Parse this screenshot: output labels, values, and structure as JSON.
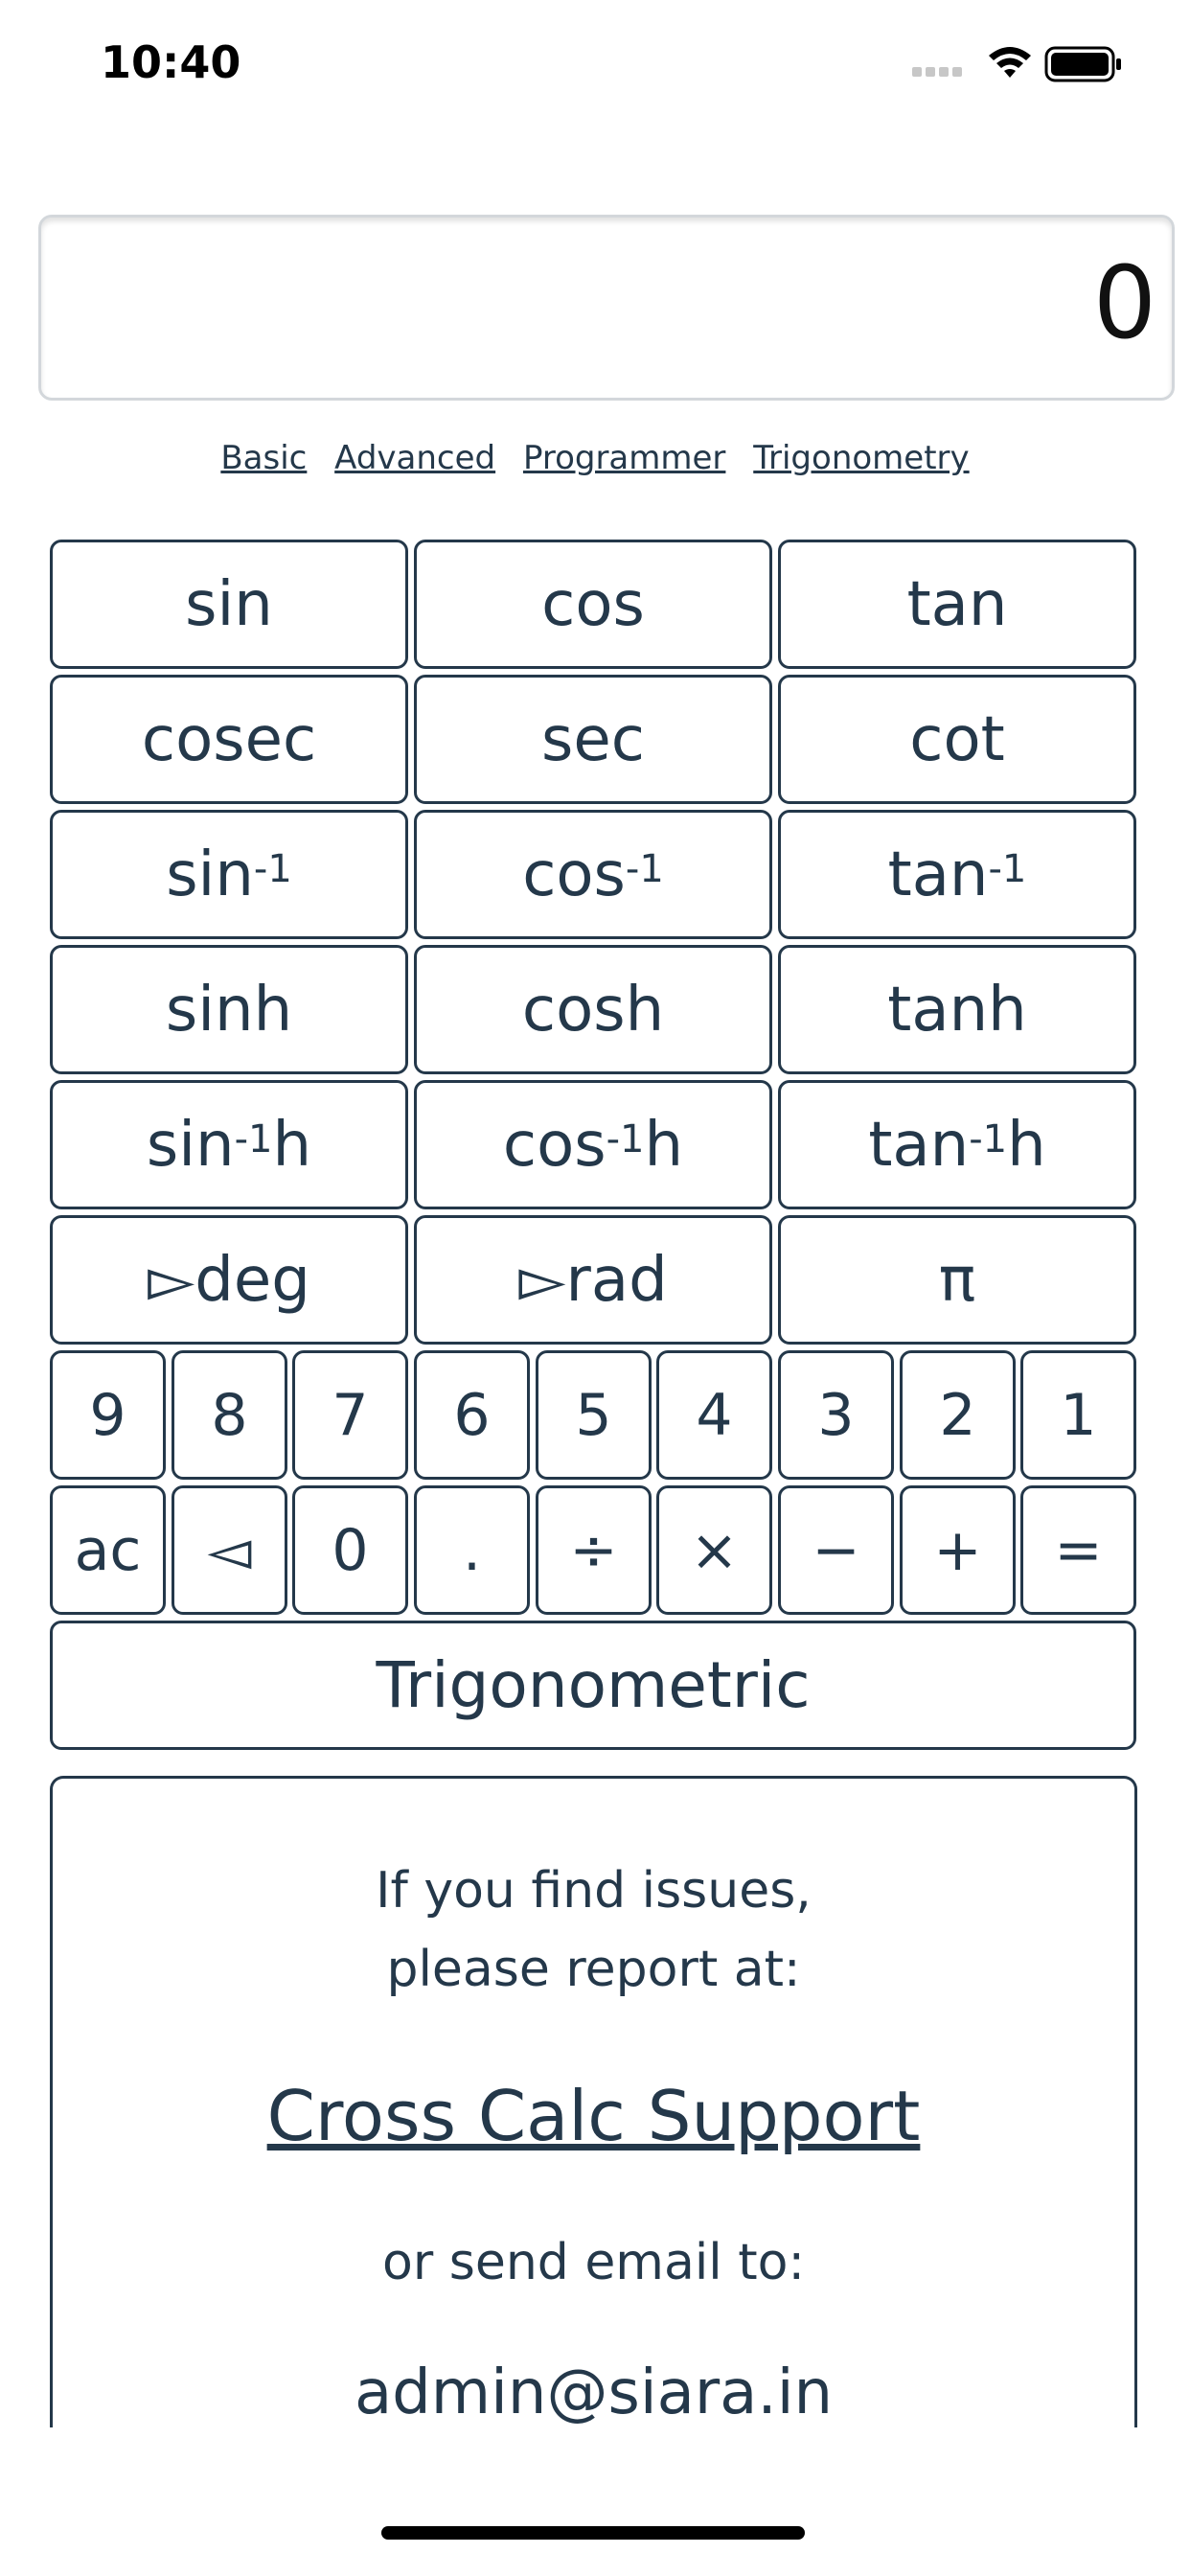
{
  "status": {
    "time": "10:40"
  },
  "display": {
    "value": "0"
  },
  "modes": [
    "Basic",
    "Advanced",
    "Programmer",
    "Trigonometry"
  ],
  "keys": {
    "sin": "sin",
    "cos": "cos",
    "tan": "tan",
    "cosec": "cosec",
    "sec": "sec",
    "cot": "cot",
    "asin_base": "sin",
    "acos_base": "cos",
    "atan_base": "tan",
    "inverse_sup": "-1",
    "sinh": "sinh",
    "cosh": "cosh",
    "tanh": "tanh",
    "asinh_base": "sin",
    "acosh_base": "cos",
    "atanh_base": "tan",
    "h_suffix": "h",
    "to_deg": "▻deg",
    "to_rad": "▻rad",
    "pi": "π",
    "digits": [
      "9",
      "8",
      "7",
      "6",
      "5",
      "4",
      "3",
      "2",
      "1"
    ],
    "ops": [
      "ac",
      "◅",
      "0",
      ".",
      "÷",
      "×",
      "−",
      "+",
      "="
    ],
    "mode_toggle": "Trigonometric"
  },
  "support": {
    "line1": "If you find issues,",
    "line2": "please report at:",
    "link": "Cross Calc Support",
    "line3": "or send email to:",
    "email": "admin@siara.in"
  }
}
